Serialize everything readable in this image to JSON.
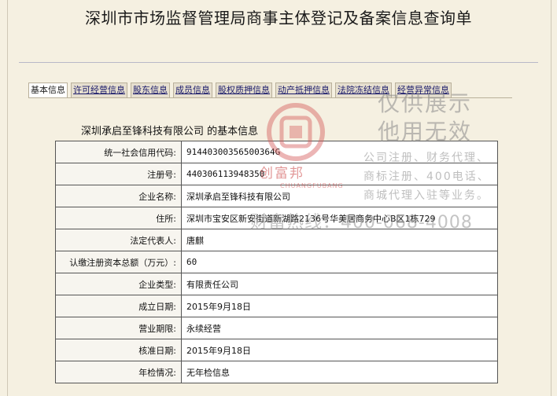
{
  "page_title": "深圳市市场监督管理局商事主体登记及备案信息查询单",
  "tabs": [
    {
      "label": "基本信息"
    },
    {
      "label": "许可经营信息"
    },
    {
      "label": "股东信息"
    },
    {
      "label": "成员信息"
    },
    {
      "label": "股权质押信息"
    },
    {
      "label": "动产抵押信息"
    },
    {
      "label": "法院冻结信息"
    },
    {
      "label": "经营异常信息"
    }
  ],
  "subtitle": "深圳承启至锋科技有限公司 的基本信息",
  "rows": [
    {
      "key": "统一社会信用代码:",
      "value": "91440300356500364G"
    },
    {
      "key": "注册号:",
      "value": "440306113948350"
    },
    {
      "key": "企业名称:",
      "value": "深圳承启至锋科技有限公司"
    },
    {
      "key": "住所:",
      "value": "深圳市宝安区新安街道新湖路2136号华美居商务中心B区1栋729"
    },
    {
      "key": "法定代表人:",
      "value": "唐麒"
    },
    {
      "key": "认缴注册资本总额（万元）:",
      "value": "60"
    },
    {
      "key": "企业类型:",
      "value": "有限责任公司"
    },
    {
      "key": "成立日期:",
      "value": "2015年9月18日"
    },
    {
      "key": "营业期限:",
      "value": "永续经营"
    },
    {
      "key": "核准日期:",
      "value": "2015年9月18日"
    },
    {
      "key": "年检情况:",
      "value": "无年检信息"
    }
  ],
  "watermark": {
    "brand": "创富邦",
    "brand_en": "CHUANGFUBANG",
    "line1": "仅供展示",
    "line2": "他用无效",
    "line3": "公司注册、财务代理、",
    "line4": "商标注册、400电话、",
    "line5": "商城代理入驻等业务。",
    "hotline": "财富热线：400-068-4008"
  }
}
